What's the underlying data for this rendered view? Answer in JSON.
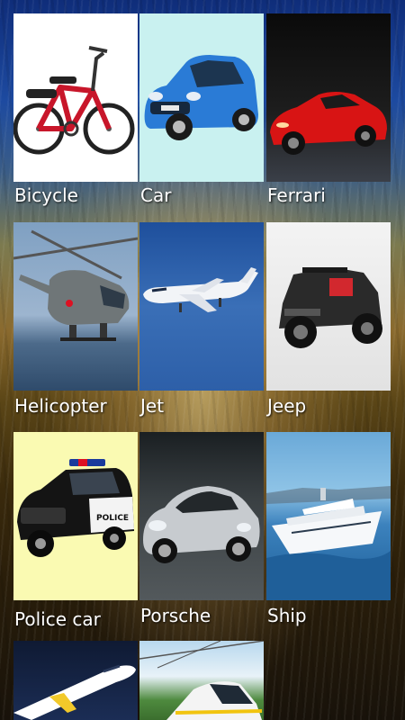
{
  "vehicles": [
    {
      "label": "Bicycle"
    },
    {
      "label": "Car"
    },
    {
      "label": "Ferrari"
    },
    {
      "label": "Helicopter"
    },
    {
      "label": "Jet"
    },
    {
      "label": "Jeep"
    },
    {
      "label": "Police car"
    },
    {
      "label": "Porsche"
    },
    {
      "label": "Ship"
    },
    {
      "label": ""
    },
    {
      "label": ""
    }
  ],
  "colors": {
    "label_text": "#ffffff",
    "background_top": "#0f2d7a",
    "background_bottom": "#18120a"
  }
}
